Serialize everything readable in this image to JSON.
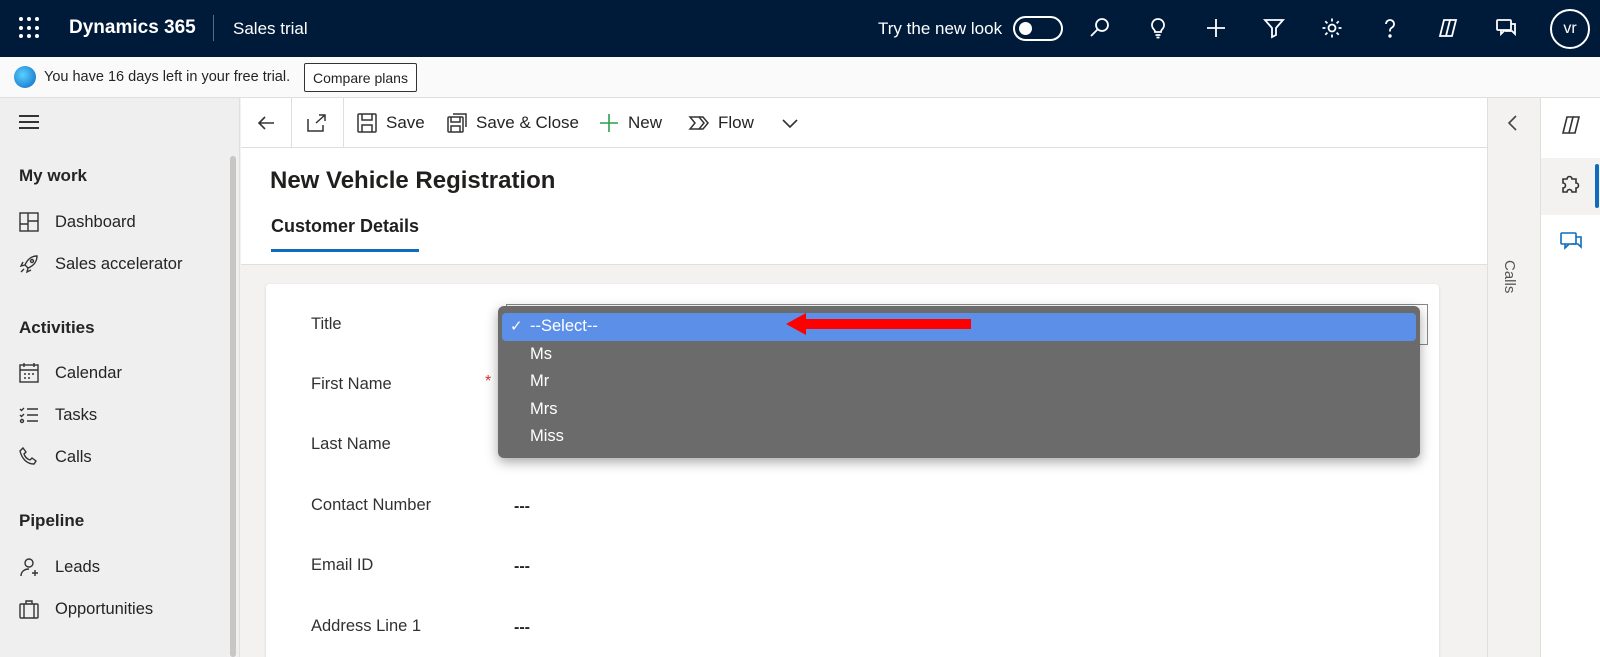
{
  "topbar": {
    "app_name": "Dynamics 365",
    "area_name": "Sales trial",
    "new_look_label": "Try the new look",
    "avatar_initials": "vr"
  },
  "trial_banner": {
    "message": "You have 16 days left in your free trial.",
    "button_label": "Compare plans"
  },
  "nav": {
    "groups": [
      {
        "title": "My work",
        "items": [
          {
            "label": "Dashboard",
            "icon": "dashboard-icon"
          },
          {
            "label": "Sales accelerator",
            "icon": "rocket-icon"
          }
        ]
      },
      {
        "title": "Activities",
        "items": [
          {
            "label": "Calendar",
            "icon": "calendar-icon"
          },
          {
            "label": "Tasks",
            "icon": "tasks-icon"
          },
          {
            "label": "Calls",
            "icon": "phone-icon"
          }
        ]
      },
      {
        "title": "Pipeline",
        "items": [
          {
            "label": "Leads",
            "icon": "lead-icon"
          },
          {
            "label": "Opportunities",
            "icon": "briefcase-icon"
          }
        ]
      }
    ]
  },
  "commands": {
    "save": "Save",
    "save_close": "Save & Close",
    "new": "New",
    "flow": "Flow"
  },
  "form": {
    "title": "New Vehicle Registration",
    "tab": "Customer Details",
    "fields": [
      {
        "label": "Title",
        "value": "",
        "required": false
      },
      {
        "label": "First Name",
        "value": "",
        "required": true
      },
      {
        "label": "Last Name",
        "value": "",
        "required": false
      },
      {
        "label": "Contact Number",
        "value": "---",
        "required": false
      },
      {
        "label": "Email ID",
        "value": "---",
        "required": false
      },
      {
        "label": "Address Line 1",
        "value": "---",
        "required": false
      }
    ],
    "required_marker": "*"
  },
  "side_panel": {
    "label": "Calls"
  },
  "dropdown": {
    "check_mark": "✓",
    "selected_index": 0,
    "options": [
      "--Select--",
      "Ms",
      "Mr",
      "Mrs",
      "Miss"
    ]
  },
  "colors": {
    "topbar_bg": "#001a3a",
    "accent": "#0f6cbd",
    "dropdown_bg": "#6b6b6b",
    "dropdown_selected": "#5b8fe8",
    "annotation_arrow": "#ff0000"
  }
}
